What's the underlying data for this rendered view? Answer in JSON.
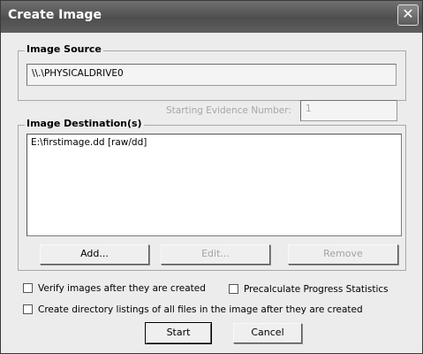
{
  "window": {
    "title": "Create Image",
    "close_glyph": "✕"
  },
  "source": {
    "legend": "Image Source",
    "value": "\\\\.\\PHYSICALDRIVE0"
  },
  "evidence": {
    "label": "Starting Evidence Number:",
    "value": "1"
  },
  "destination": {
    "legend": "Image Destination(s)",
    "items": [
      "E:\\firstimage.dd [raw/dd]"
    ],
    "add_label": "Add...",
    "edit_label": "Edit...",
    "remove_label": "Remove"
  },
  "options": {
    "verify_label": "Verify images after they are created",
    "precalc_label": "Precalculate Progress Statistics",
    "listing_label": "Create directory listings of all files in the image after they are created"
  },
  "actions": {
    "start_label": "Start",
    "cancel_label": "Cancel"
  }
}
